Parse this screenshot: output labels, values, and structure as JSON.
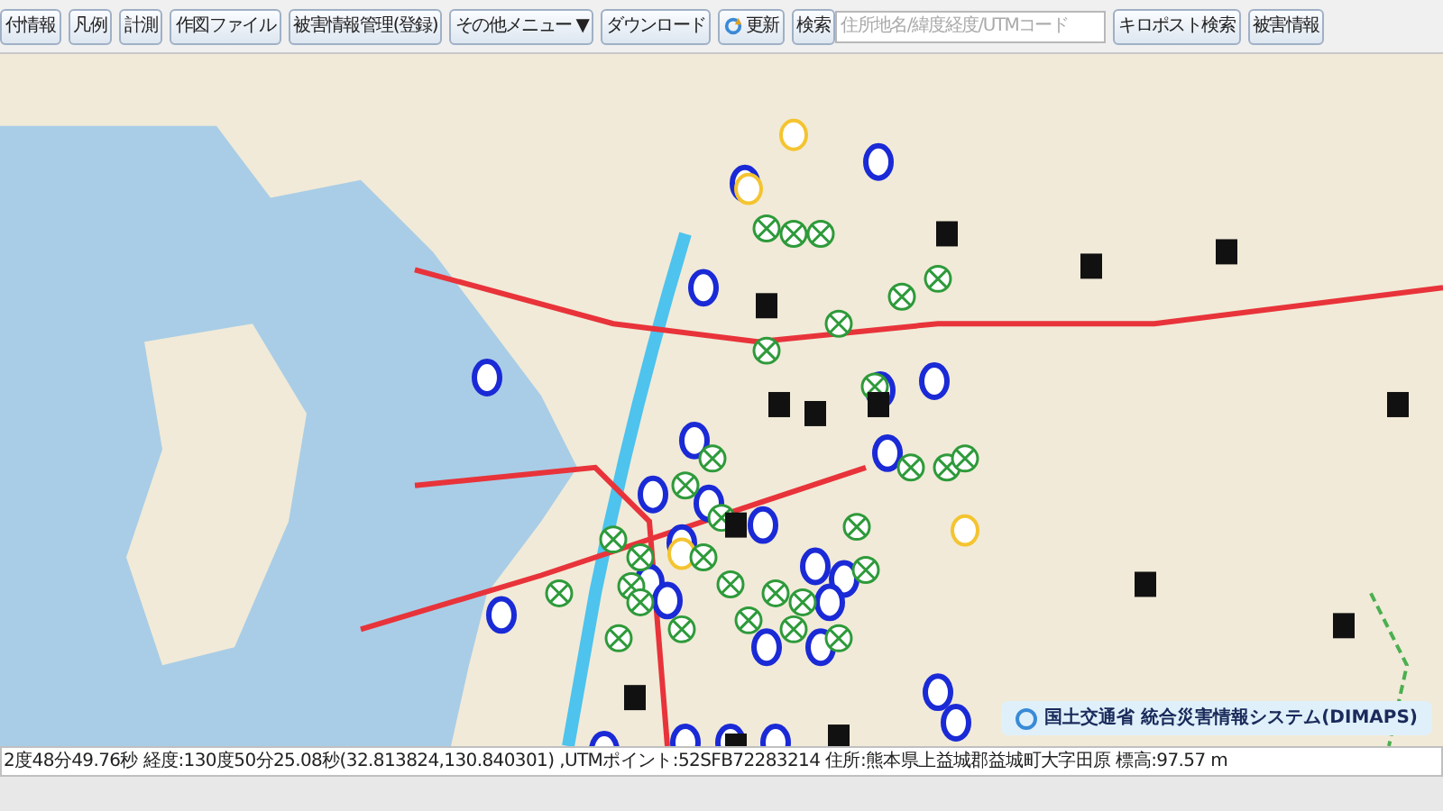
{
  "toolbar": {
    "buttons": [
      {
        "label": "付情報",
        "kind": "plain"
      },
      {
        "label": "凡例",
        "kind": "plain"
      },
      {
        "label": "計測",
        "kind": "plain"
      },
      {
        "label": "作図ファイル",
        "kind": "plain"
      },
      {
        "label": "被害情報管理(登録)",
        "kind": "plain"
      },
      {
        "label": "その他メニュー ▼",
        "kind": "plain"
      },
      {
        "label": "ダウンロード",
        "kind": "plain"
      },
      {
        "label": "更新",
        "kind": "refresh"
      },
      {
        "label": "検索",
        "kind": "plain"
      }
    ],
    "search": {
      "placeholder": "住所地名/緯度経度/UTMコード"
    },
    "right_buttons": [
      "キロポスト検索",
      "被害情報"
    ]
  },
  "map": {
    "credit": "国土交通省 統合災害情報システム(DIMAPS)"
  },
  "status_bar": {
    "text": "2度48分49.76秒 経度:130度50分25.08秒(32.813824,130.840301) ,UTMポイント:52SFB72283214 住所:熊本県上益城郡益城町大字田原 標高:97.57 m"
  }
}
